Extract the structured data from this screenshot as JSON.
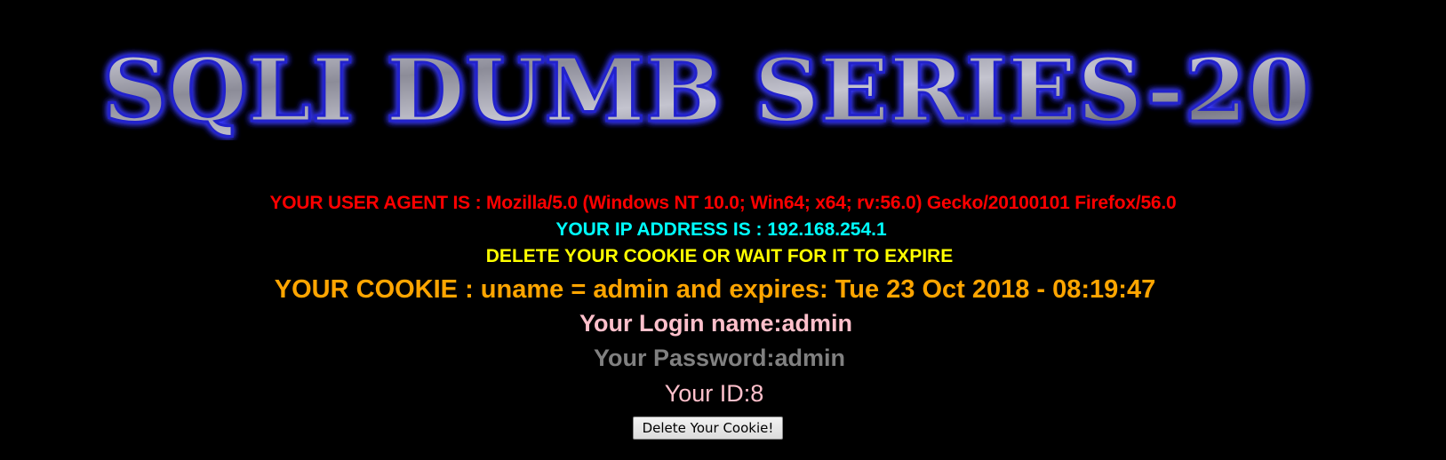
{
  "banner": {
    "text": "SQLI DUMB SERIES-20"
  },
  "info": {
    "user_agent": "YOUR USER AGENT IS : Mozilla/5.0 (Windows NT 10.0; Win64; x64; rv:56.0) Gecko/20100101 Firefox/56.0",
    "ip_address": "YOUR IP ADDRESS IS : 192.168.254.1",
    "cookie_notice": "DELETE YOUR COOKIE OR WAIT FOR IT TO EXPIRE",
    "cookie": "YOUR COOKIE : uname = admin and expires: Tue 23 Oct 2018 - 08:19:47",
    "login_name": "Your Login name:admin",
    "password": "Your Password:admin",
    "id": "Your ID:8"
  },
  "actions": {
    "delete_cookie_label": "Delete Your Cookie!"
  },
  "colors": {
    "background": "#000000",
    "user_agent": "#ff0000",
    "ip_address": "#00ffff",
    "cookie_notice": "#ffff00",
    "cookie": "#ffa500",
    "login_name": "#ffc0cb",
    "password": "#808080",
    "id": "#ffc0cb",
    "banner_fill": "#a9a9b4",
    "banner_glow": "#2a2aff"
  }
}
